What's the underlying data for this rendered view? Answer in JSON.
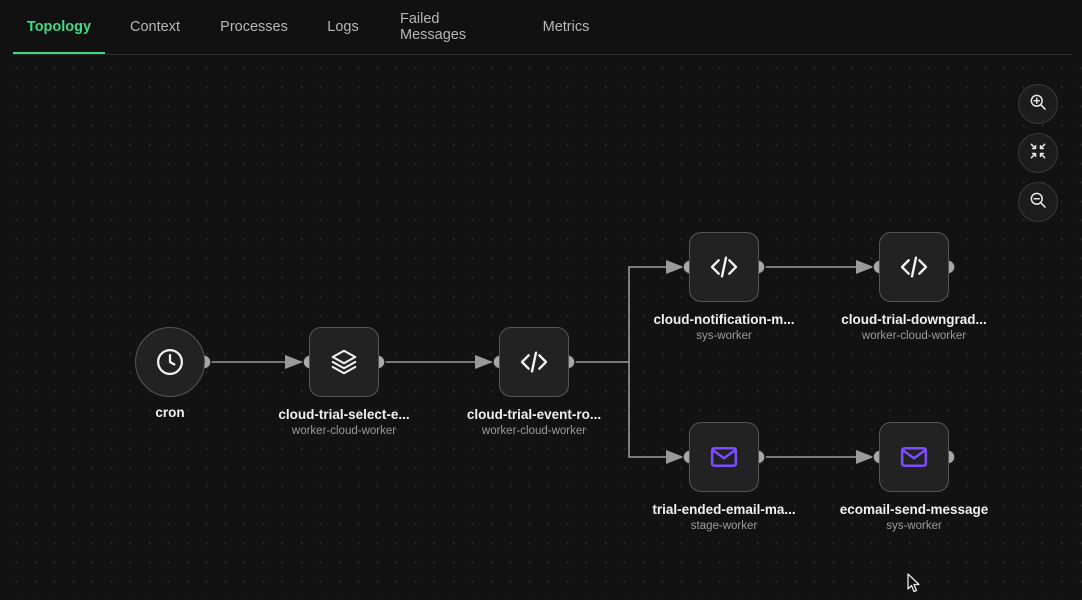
{
  "tabs": [
    {
      "label": "Topology",
      "active": true
    },
    {
      "label": "Context",
      "active": false
    },
    {
      "label": "Processes",
      "active": false
    },
    {
      "label": "Logs",
      "active": false
    },
    {
      "label": "Failed Messages",
      "active": false
    },
    {
      "label": "Metrics",
      "active": false
    }
  ],
  "nodes": {
    "cron": {
      "label": "cron",
      "icon": "clock-icon"
    },
    "select": {
      "label": "cloud-trial-select-e...",
      "worker": "worker-cloud-worker",
      "icon": "layers-icon"
    },
    "router": {
      "label": "cloud-trial-event-ro...",
      "worker": "worker-cloud-worker",
      "icon": "code-icon"
    },
    "notification": {
      "label": "cloud-notification-m...",
      "worker": "sys-worker",
      "icon": "code-icon"
    },
    "downgrade": {
      "label": "cloud-trial-downgrad...",
      "worker": "worker-cloud-worker",
      "icon": "code-icon"
    },
    "trial_email": {
      "label": "trial-ended-email-ma...",
      "worker": "stage-worker",
      "icon": "mail-icon"
    },
    "ecomail": {
      "label": "ecomail-send-message",
      "worker": "sys-worker",
      "icon": "mail-icon"
    }
  },
  "zoom_controls": [
    "zoom-in-icon",
    "fit-view-icon",
    "zoom-out-icon"
  ],
  "colors": {
    "accent": "#3ddc84",
    "mail_icon": "#7c4dff",
    "edge": "#9a9a9a",
    "background": "#121212"
  }
}
